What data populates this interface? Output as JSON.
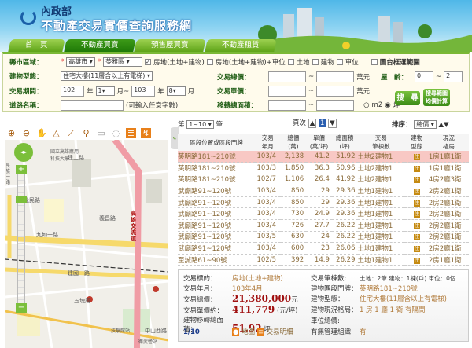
{
  "header": {
    "org": "內政部",
    "site_title": "不動產交易實價查詢服務網"
  },
  "tabs": [
    "首　頁",
    "不動產買賣",
    "預售屋買賣",
    "不動產租賃"
  ],
  "form": {
    "region_label": "縣市區域：",
    "city": "高雄市",
    "district": "苓雅區",
    "checkboxes": [
      {
        "label": "房地(土地+建物)",
        "checked": true
      },
      {
        "label": "房地(土地+建物)+車位",
        "checked": false
      },
      {
        "label": "土地",
        "checked": false
      },
      {
        "label": "建物",
        "checked": false
      },
      {
        "label": "車位",
        "checked": false
      }
    ],
    "map_select_label": "圖台框選範圍",
    "building_type_label": "建物型態：",
    "building_type": "住宅大樓(11層含以上有電梯)",
    "total_price_label": "交易總價：",
    "unit_wan": "萬元",
    "age_label": "屋　齡：",
    "age_from": "0",
    "age_to": "2",
    "period_label": "交易期間：",
    "year_from": "102",
    "month_from": "1",
    "year_to": "103",
    "month_to": "8",
    "year_unit": "年",
    "month_unit": "月",
    "month_tilde": "月~",
    "unit_price_label": "交易單價：",
    "road_label": "道路名稱：",
    "road_hint": "(可輸入任意字數)",
    "area_label": "移轉總面積：",
    "unit_m2": "m2",
    "unit_ping": "坪",
    "tilde": "~",
    "search_button": "搜　尋",
    "calc_button": "搜尋範圍均價計算"
  },
  "map": {
    "labels": [
      "國立高雄應用科技大學",
      "建工路",
      "九如一路",
      "高雄交流道",
      "建國一路",
      "中山西路",
      "五塊厝",
      "技擊館站",
      "衛武營站",
      "民族一路",
      "覺民路",
      "義昌路"
    ]
  },
  "results": {
    "range_prefix": "第",
    "range": "1~10",
    "range_suffix": "筆",
    "page_label": "頁次",
    "page": "1",
    "sort_label": "排序：",
    "sort": "總價",
    "headers": [
      "區段位置或區段門牌",
      "交易\n年月",
      "總價\n(萬)",
      "單價\n(萬/坪)",
      "總面積\n(坪)",
      "交易\n筆棟數",
      "建物\n型態",
      "現況\n格局"
    ],
    "rows": [
      [
        "英明路181~210號",
        "103/4",
        "2,138",
        "41.2",
        "51.92",
        "土地2建物1",
        "住",
        "1房1廳1衛"
      ],
      [
        "英明路181~210號",
        "103/3",
        "1,850",
        "36.3",
        "50.96",
        "土地2建物1",
        "住",
        "1房1廳1衛"
      ],
      [
        "英明路181~210號",
        "102/7",
        "1,106",
        "26.4",
        "41.92",
        "土地2建物1",
        "住",
        "4房2廳3衛"
      ],
      [
        "武廟路91~120號",
        "103/4",
        "850",
        "29",
        "29.36",
        "土地1建物1",
        "住",
        "2房2廳1衛"
      ],
      [
        "武廟路91~120號",
        "103/4",
        "850",
        "29",
        "29.36",
        "土地1建物1",
        "住",
        "2房2廳1衛"
      ],
      [
        "武廟路91~120號",
        "103/4",
        "730",
        "24.9",
        "29.36",
        "土地1建物1",
        "住",
        "2房2廳1衛"
      ],
      [
        "武廟路91~120號",
        "103/4",
        "726",
        "27.7",
        "26.22",
        "土地1建物1",
        "住",
        "2房2廳1衛"
      ],
      [
        "武廟路91~120號",
        "103/5",
        "630",
        "24",
        "26.22",
        "土地1建物1",
        "住",
        "2房2廳1衛"
      ],
      [
        "武廟路91~120號",
        "103/4",
        "600",
        "23",
        "26.06",
        "土地1建物1",
        "住",
        "2房2廳1衛"
      ],
      [
        "至誠路61~90號",
        "102/5",
        "392",
        "14.9",
        "26.29",
        "土地1建物1",
        "住",
        "2房1廳1衛"
      ]
    ]
  },
  "detail": {
    "target_label": "交易標的：",
    "target": "房地(土地+建物)",
    "date_label": "交易年月：",
    "date": "103年4月",
    "total_label": "交易總價：",
    "total": "21,380,000",
    "total_unit": "元",
    "unit_label": "交易單價約：",
    "unit": "411,779",
    "unit_unit": "(元/坪)",
    "area_label": "建物移轉總面積：",
    "area": "51.92",
    "area_unit": "坪",
    "pager": "1/10",
    "map_link": "地圖",
    "detail_link": "交易明細",
    "count_label": "交易筆棟數:",
    "count": "土地：2筆 建物：1棟(戶) 車位：0個",
    "addr_label": "建物區段門牌：",
    "addr": "英明路181~210號",
    "type_label": "建物型態：",
    "type": "住宅大樓(11層含以上有電梯)",
    "layout_label": "建物現況格局：",
    "layout": "1 房 1 廳 1 衛 有隔間",
    "parking_label": "車位總價:",
    "mgmt_label": "有無管理組織:",
    "mgmt": "有"
  }
}
